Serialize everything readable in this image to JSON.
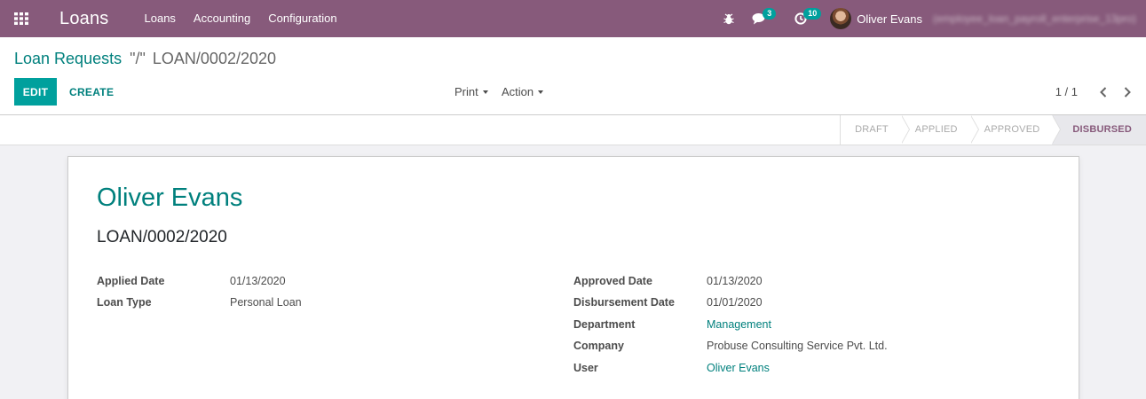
{
  "navbar": {
    "app_name": "Loans",
    "menu": [
      "Loans",
      "Accounting",
      "Configuration"
    ],
    "messages_count": "3",
    "activities_count": "10",
    "user_name": "Oliver Evans",
    "db_name": "(employee_loan_payroll_enterprise_13pro)",
    "icons": {
      "apps": "grid-icon",
      "debug": "bug-icon",
      "messages": "chat-icon",
      "activities": "clock-icon"
    }
  },
  "breadcrumb": {
    "parent": "Loan Requests",
    "separator": "\"/\"",
    "current": "LOAN/0002/2020"
  },
  "buttons": {
    "edit": "EDIT",
    "create": "CREATE",
    "print": "Print",
    "action": "Action"
  },
  "pager": {
    "value": "1 / 1"
  },
  "stages": [
    "DRAFT",
    "APPLIED",
    "APPROVED",
    "DISBURSED"
  ],
  "active_stage": "DISBURSED",
  "colors": {
    "brand": "#875a7b",
    "accent": "#00a09d",
    "link": "#00807d"
  },
  "record": {
    "employee": "Oliver Evans",
    "loan_ref": "LOAN/0002/2020",
    "left_fields": [
      {
        "label": "Applied Date",
        "value": "01/13/2020"
      },
      {
        "label": "Loan Type",
        "value": "Personal Loan"
      }
    ],
    "right_fields": [
      {
        "label": "Approved Date",
        "value": "01/13/2020"
      },
      {
        "label": "Disbursement Date",
        "value": "01/01/2020"
      },
      {
        "label": "Department",
        "value": "Management"
      },
      {
        "label": "Company",
        "value": "Probuse Consulting Service Pvt. Ltd."
      },
      {
        "label": "User",
        "value": "Oliver Evans"
      }
    ]
  }
}
